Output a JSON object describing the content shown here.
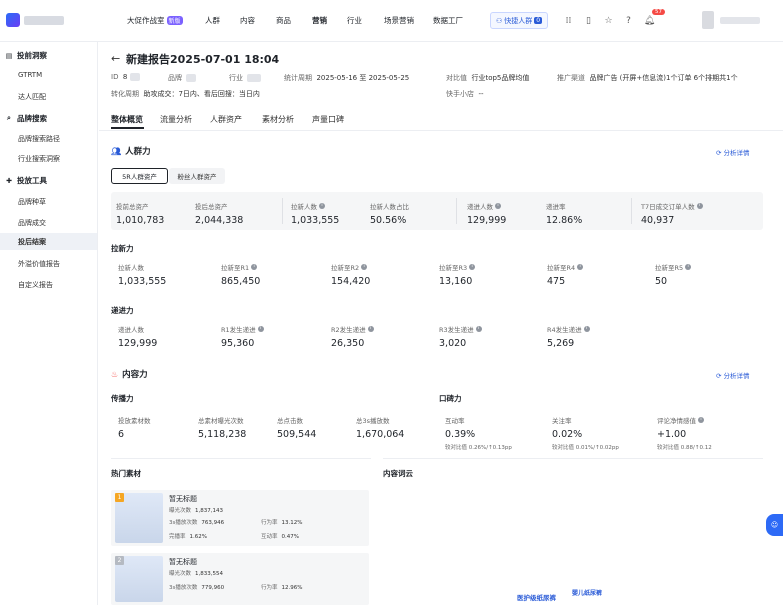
{
  "header": {
    "nav": [
      "大促作战室",
      "人群",
      "内容",
      "商品",
      "营销",
      "行业",
      "场景营销",
      "数据工厂"
    ],
    "nav_badge": "新版",
    "quick_label": "快捷人群",
    "quick_count": "0",
    "notif_count": "57",
    "icons": [
      "grid-icon",
      "phone-icon",
      "star-icon",
      "help-icon",
      "bell-icon"
    ]
  },
  "sidebar": {
    "groups": [
      {
        "label": "投前洞察",
        "icon": "book-icon",
        "items": [
          "GTRTM",
          "达人匹配"
        ]
      },
      {
        "label": "品牌搜索",
        "icon": "search-icon",
        "items": [
          "品牌搜索路径",
          "行业搜索洞察"
        ]
      },
      {
        "label": "投放工具",
        "icon": "pin-icon",
        "items": [
          "品牌种草",
          "品牌成交",
          "投后结案",
          "外溢价值报告",
          "自定义报告"
        ]
      }
    ],
    "active_item": "投后结案"
  },
  "report": {
    "back": "←",
    "title": "新建报告2025-07-01 18:04",
    "meta": {
      "id_label": "ID",
      "id_value": "8",
      "brand_label": "品牌",
      "industry_label": "行业",
      "period_label": "统计周期",
      "period_value": "2025-05-16 至 2025-05-25",
      "compare_label": "对比值",
      "compare_value": "行业top5品牌均值",
      "channel_label": "推广渠道",
      "channel_value": "品牌广告 (开屏+信息流)1个订单 6个排期共1个",
      "cycle_label": "转化周期",
      "cycle_value": "助攻成交：7日内、看后回搜：当日内",
      "shop_label": "快手小店",
      "shop_value": "--"
    },
    "tabs": [
      "整体概览",
      "流量分析",
      "人群资产",
      "素材分析",
      "声量口碑"
    ]
  },
  "crowd": {
    "title": "人群力",
    "detail_link": "分析详情",
    "pills": [
      "5R人群资产",
      "粉丝人群资产"
    ],
    "summary": [
      {
        "label": "投前总资产",
        "value": "1,010,783"
      },
      {
        "label": "投后总资产",
        "value": "2,044,338"
      },
      {
        "label": "拉新人数",
        "value": "1,033,555"
      },
      {
        "label": "拉新人数占比",
        "value": "50.56%"
      },
      {
        "label": "递进人数",
        "value": "129,999"
      },
      {
        "label": "递进率",
        "value": "12.86%"
      },
      {
        "label": "T7日成交订单人数",
        "value": "40,937"
      }
    ],
    "new_title": "拉新力",
    "new_metrics": [
      {
        "label": "拉新人数",
        "value": "1,033,555"
      },
      {
        "label": "拉新至R1",
        "value": "865,450"
      },
      {
        "label": "拉新至R2",
        "value": "154,420"
      },
      {
        "label": "拉新至R3",
        "value": "13,160"
      },
      {
        "label": "拉新至R4",
        "value": "475"
      },
      {
        "label": "拉新至R5",
        "value": "50"
      }
    ],
    "adv_title": "递进力",
    "adv_metrics": [
      {
        "label": "递进人数",
        "value": "129,999"
      },
      {
        "label": "R1发生递进",
        "value": "95,360"
      },
      {
        "label": "R2发生递进",
        "value": "26,350"
      },
      {
        "label": "R3发生递进",
        "value": "3,020"
      },
      {
        "label": "R4发生递进",
        "value": "5,269"
      }
    ]
  },
  "content": {
    "title": "内容力",
    "detail_link": "分析详情",
    "spread_title": "传播力",
    "spread": [
      {
        "label": "投放素材数",
        "value": "6"
      },
      {
        "label": "总素材曝光次数",
        "value": "5,118,238"
      },
      {
        "label": "总点击数",
        "value": "509,544"
      },
      {
        "label": "总3s播放数",
        "value": "1,670,064"
      }
    ],
    "wom_title": "口碑力",
    "wom": [
      {
        "label": "互动率",
        "value": "0.39%",
        "compare": "较对比值 0.26%/↑0.13pp"
      },
      {
        "label": "关注率",
        "value": "0.02%",
        "compare": "较对比值 0.01%/↑0.02pp"
      },
      {
        "label": "评论净情感值",
        "value": "+1.00",
        "compare": "较对比值 0.88/↑0.12"
      }
    ],
    "hot_title": "热门素材",
    "cloud_title": "内容词云",
    "materials": [
      {
        "rank": "1",
        "name": "暂无标题",
        "exposure_label": "曝光次数",
        "exposure": "1,837,143",
        "play_label": "3s播放次数",
        "play": "763,946",
        "act_label": "行为率",
        "act": "13.12%",
        "finish_label": "完播率",
        "finish": "1.62%",
        "inter_label": "互动率",
        "inter": "0.47%"
      },
      {
        "rank": "2",
        "name": "暂无标题",
        "exposure_label": "曝光次数",
        "exposure": "1,833,554",
        "play_label": "3s播放次数",
        "play": "779,960",
        "act_label": "行为率",
        "act": "12.96%"
      }
    ],
    "cloud_words": [
      "医护级纸尿裤",
      "婴儿纸尿裤"
    ]
  }
}
